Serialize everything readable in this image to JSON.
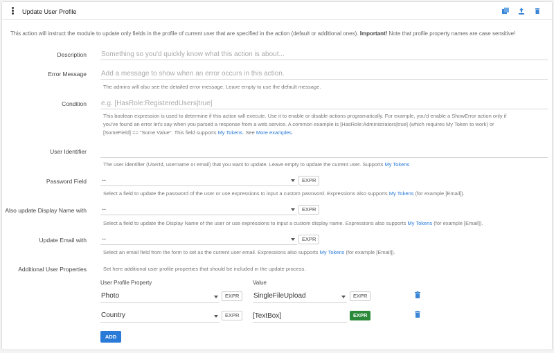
{
  "header": {
    "title": "Update User Profile",
    "icons": [
      "copy-icon",
      "upload-icon",
      "delete-icon"
    ]
  },
  "intro": {
    "text": "This action will instruct the module to update only fields in the profile of current user that are specified in the action (default or additional ones).",
    "important": "Important!",
    "note": "Note that profile property names are case sensitive!"
  },
  "description": {
    "label": "Description",
    "placeholder": "Something so you'd quickly know what this action is about..."
  },
  "error_message": {
    "label": "Error Message",
    "placeholder": "Add a message to show when an error occurs in this action.",
    "help": "The admins will also see the detailed error message. Leave empty to use the default message."
  },
  "condition": {
    "label": "Condition",
    "placeholder": "e.g. [HasRole:RegisteredUsers|true]",
    "help_line1": "This boolean expression is used to determine if this action will execute. Use it to enable or disable actions programatically. For example, you'd enable a ShowError action only if",
    "help_line2": "you've found an error let's say when you parsed a response from a web service. A common example is [HasRole:Administrators|true] (which requires My Token to work) or",
    "help_line3_pre": "[SomeField] == \"Some Value\". This field supports",
    "help_link1": "My Tokens",
    "help_line3_mid": ". See",
    "help_link2": "More examples",
    "help_line3_end": "."
  },
  "user_identifier": {
    "label": "User Identifier",
    "value": "",
    "help_pre": "The user identifier (UserId, username or email) that you want to update. Leave empty to update the current user. Supports",
    "help_link": "My Tokens"
  },
  "password_field": {
    "label": "Password Field",
    "value": "--",
    "expr_label": "EXPR",
    "help_pre": "Select a field to update the password of the user or use expressions to input a custom password. Expressions also supports",
    "help_link": "My Tokens",
    "help_post": "(for example [Email])."
  },
  "display_name": {
    "label": "Also update Display Name with",
    "value": "--",
    "expr_label": "EXPR",
    "help_pre": "Select a field to update the Display Name of the user or use expressions to input a custom display name. Expressions also supports",
    "help_link": "My Tokens",
    "help_post": "(for example [Email])."
  },
  "update_email": {
    "label": "Update Email with",
    "value": "--",
    "expr_label": "EXPR",
    "help_pre": "Select an email field from the form to set as the current user email. Expressions also supports",
    "help_link": "My Tokens",
    "help_post": "(for example [Email])."
  },
  "additional": {
    "label": "Additional User Properties",
    "help": "Set here additional user profile properties that should be included in the update process.",
    "col_property": "User Profile Property",
    "col_value": "Value",
    "rows": [
      {
        "property": "Photo",
        "property_expr": "EXPR",
        "value": "SingleFileUpload",
        "value_expr": "EXPR",
        "value_is_expr": false
      },
      {
        "property": "Country",
        "property_expr": "EXPR",
        "value": "[TextBox]",
        "value_expr": "EXPR",
        "value_is_expr": true
      }
    ],
    "add_label": "ADD"
  },
  "colors": {
    "accent": "#2a7ad8",
    "expr_active": "#2a8a3a"
  }
}
